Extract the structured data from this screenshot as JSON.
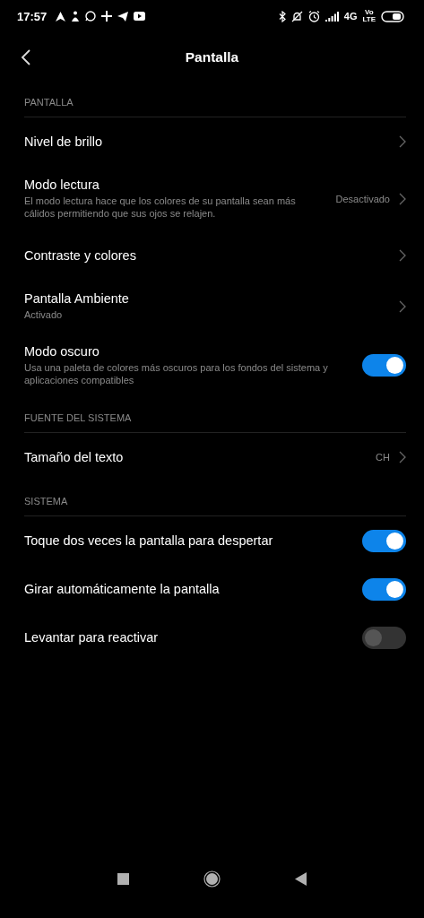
{
  "status_bar": {
    "time": "17:57",
    "network": "4G",
    "volte": "Vo\nLTE"
  },
  "header": {
    "title": "Pantalla"
  },
  "sections": [
    {
      "title": "PANTALLA",
      "items": [
        {
          "kind": "link",
          "title": "Nivel de brillo"
        },
        {
          "kind": "link",
          "title": "Modo lectura",
          "subtitle": "El modo lectura hace que los colores de su pantalla sean más cálidos permitiendo que sus ojos se relajen.",
          "value": "Desactivado"
        },
        {
          "kind": "link",
          "title": "Contraste y colores"
        },
        {
          "kind": "link",
          "title": "Pantalla Ambiente",
          "subtitle": "Activado"
        },
        {
          "kind": "toggle",
          "title": "Modo oscuro",
          "subtitle": "Usa una paleta de colores más oscuros para los fondos del sistema y aplicaciones compatibles",
          "on": true
        }
      ]
    },
    {
      "title": "FUENTE DEL SISTEMA",
      "items": [
        {
          "kind": "link",
          "title": "Tamaño del texto",
          "value": "CH"
        }
      ]
    },
    {
      "title": "SISTEMA",
      "items": [
        {
          "kind": "toggle",
          "title": "Toque dos veces la pantalla para despertar",
          "on": true
        },
        {
          "kind": "toggle",
          "title": "Girar automáticamente la pantalla",
          "on": true
        },
        {
          "kind": "toggle",
          "title": "Levantar para reactivar",
          "on": false
        }
      ]
    }
  ]
}
